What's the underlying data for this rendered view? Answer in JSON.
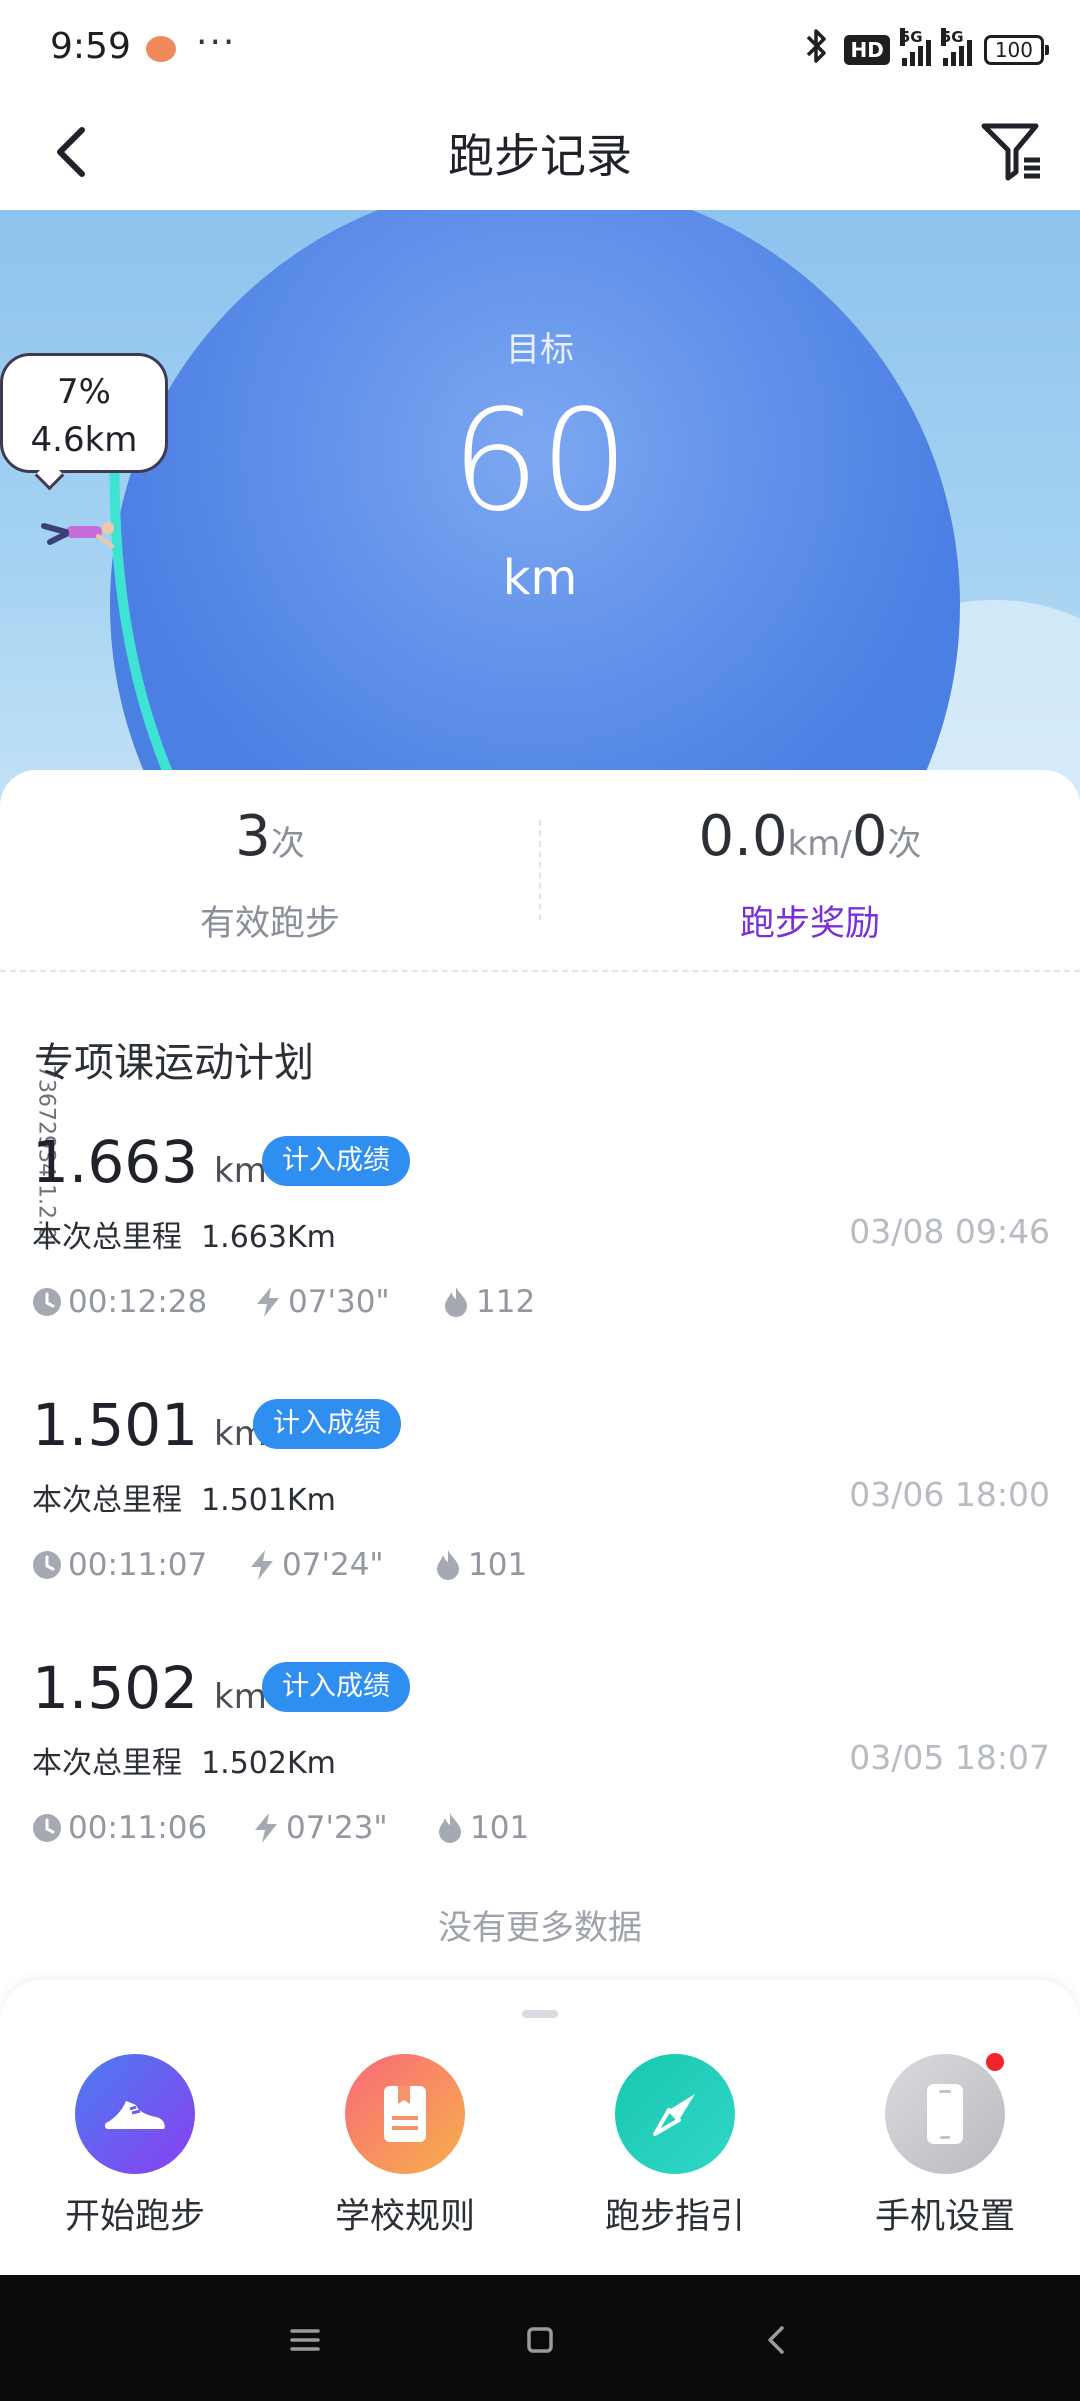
{
  "status_bar": {
    "time": "9:59",
    "more": "···",
    "hd_label": "HD",
    "network_1": "5G",
    "network_2": "5G",
    "battery": "100"
  },
  "header": {
    "title": "跑步记录"
  },
  "hero": {
    "goal_label": "目标",
    "goal_value": "60",
    "goal_unit": "km",
    "progress_percent": "7%",
    "progress_distance": "4.6km",
    "progress_fraction": 0.07
  },
  "stats": {
    "count_value": "3",
    "count_unit": "次",
    "count_label": "有效跑步",
    "reward_km": "0.0",
    "reward_km_unit": "km/",
    "reward_times": "0",
    "reward_times_unit": "次",
    "reward_label": "跑步奖励"
  },
  "side_version": "73672934 1.2.0",
  "section_title": "专项课运动计划",
  "records": [
    {
      "distance": "1.663",
      "unit": "km",
      "badge": "计入成绩",
      "total_label": "本次总里程",
      "total_value": "1.663Km",
      "date": "03/08 09:46",
      "duration": "00:12:28",
      "pace": "07'30\"",
      "calories": "112"
    },
    {
      "distance": "1.501",
      "unit": "km",
      "badge": "计入成绩",
      "total_label": "本次总里程",
      "total_value": "1.501Km",
      "date": "03/06 18:00",
      "duration": "00:11:07",
      "pace": "07'24\"",
      "calories": "101"
    },
    {
      "distance": "1.502",
      "unit": "km",
      "badge": "计入成绩",
      "total_label": "本次总里程",
      "total_value": "1.502Km",
      "date": "03/05 18:07",
      "duration": "00:11:06",
      "pace": "07'23\"",
      "calories": "101"
    }
  ],
  "no_more": "没有更多数据",
  "actions": [
    {
      "label": "开始跑步",
      "icon": "shoe-icon"
    },
    {
      "label": "学校规则",
      "icon": "rulebook-icon"
    },
    {
      "label": "跑步指引",
      "icon": "compass-icon"
    },
    {
      "label": "手机设置",
      "icon": "phone-icon"
    }
  ],
  "colors": {
    "accent": "#2f8ff0",
    "reward": "#7b2fd8",
    "progress_arc": "#3fe3d4",
    "globe": "#4b7fe3"
  }
}
